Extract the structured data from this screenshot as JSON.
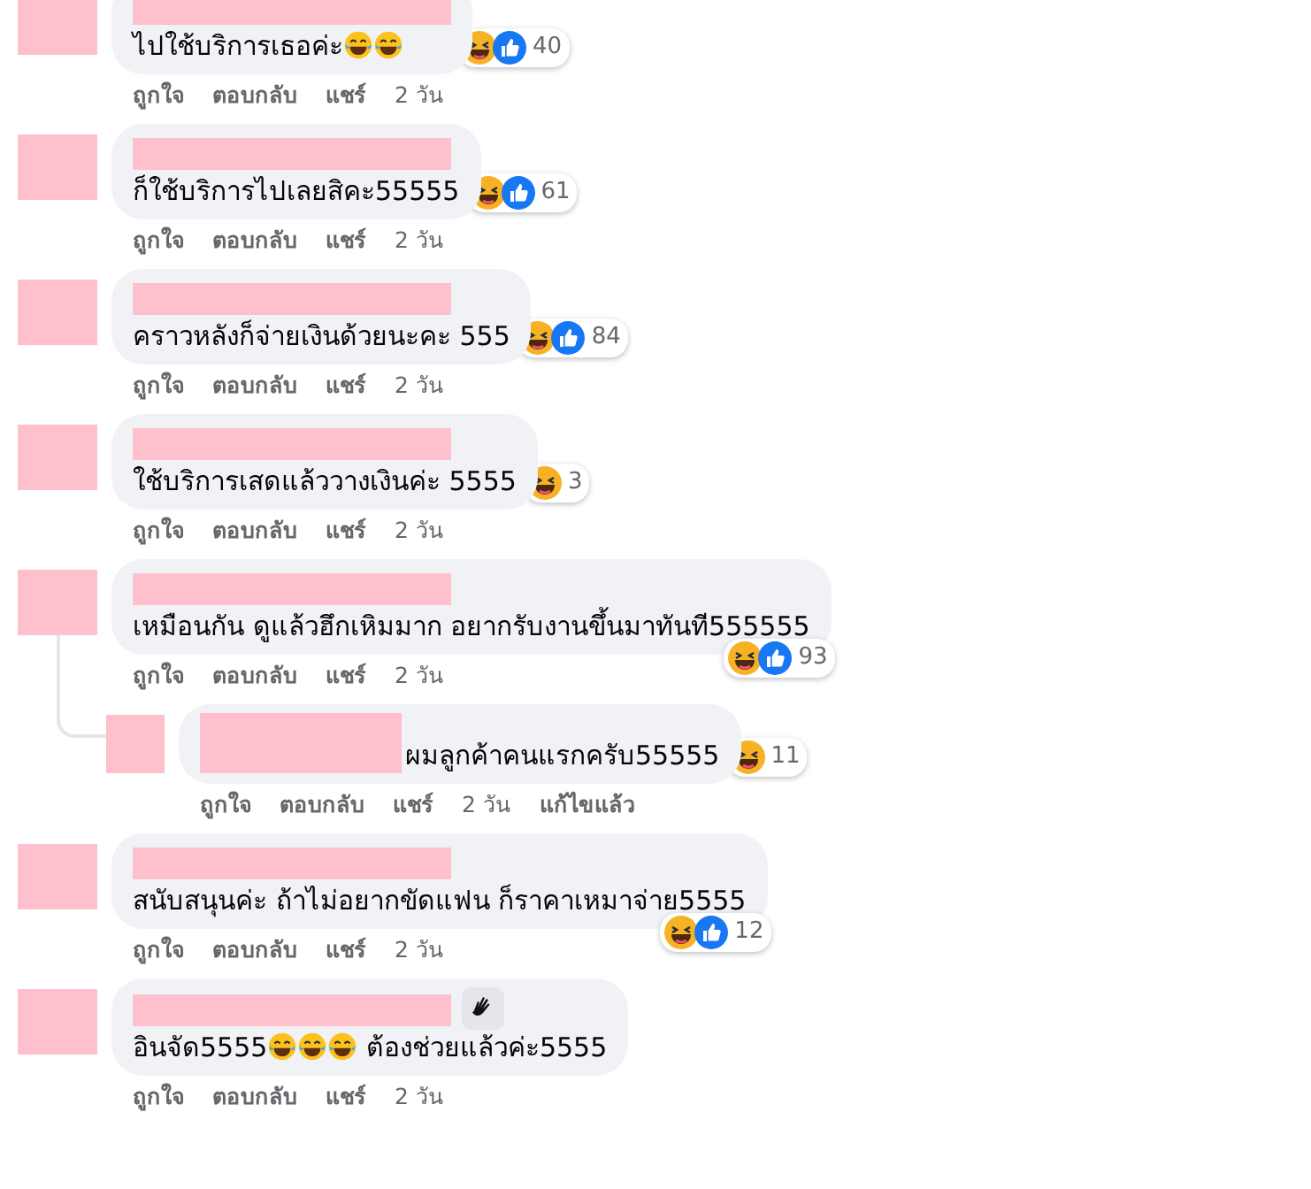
{
  "comments": [
    {
      "kind": "stacked",
      "name_badge": false,
      "parts": [
        {
          "kind": "text",
          "text": "ไปใช้บริการเธอค่ะ"
        },
        {
          "kind": "emoji"
        },
        {
          "kind": "emoji"
        }
      ],
      "reactions": {
        "under": false,
        "icons": [
          {
            "kind": "haha"
          },
          {
            "kind": "like"
          }
        ],
        "count": "40"
      },
      "actions": [
        "ถูกใจ",
        "ตอบกลับ",
        "แชร์",
        "2 วัน"
      ]
    },
    {
      "kind": "stacked",
      "name_badge": false,
      "parts": [
        {
          "kind": "text",
          "text": "ก็ใช้บริการไปเลยสิคะ55555"
        }
      ],
      "reactions": {
        "under": false,
        "icons": [
          {
            "kind": "haha"
          },
          {
            "kind": "like"
          }
        ],
        "count": "61"
      },
      "actions": [
        "ถูกใจ",
        "ตอบกลับ",
        "แชร์",
        "2 วัน"
      ]
    },
    {
      "kind": "stacked",
      "name_badge": false,
      "parts": [
        {
          "kind": "text",
          "text": "คราวหลังก็จ่ายเงินด้วยนะคะ 555"
        }
      ],
      "reactions": {
        "under": false,
        "icons": [
          {
            "kind": "haha"
          },
          {
            "kind": "like"
          }
        ],
        "count": "84"
      },
      "actions": [
        "ถูกใจ",
        "ตอบกลับ",
        "แชร์",
        "2 วัน"
      ]
    },
    {
      "kind": "stacked",
      "name_badge": false,
      "parts": [
        {
          "kind": "text",
          "text": "ใช้บริการเสดแล้ววางเงินค่ะ 5555"
        }
      ],
      "reactions": {
        "under": false,
        "icons": [
          {
            "kind": "haha"
          }
        ],
        "count": "3"
      },
      "actions": [
        "ถูกใจ",
        "ตอบกลับ",
        "แชร์",
        "2 วัน"
      ]
    },
    {
      "kind": "stacked",
      "name_badge": false,
      "parts": [
        {
          "kind": "text",
          "text": "เหมือนกัน ดูแล้วฮึกเหิมมาก อยากรับงานขึ้นมาทันที555555"
        }
      ],
      "reactions": {
        "under": true,
        "icons": [
          {
            "kind": "haha"
          },
          {
            "kind": "like"
          }
        ],
        "count": "93"
      },
      "actions": [
        "ถูกใจ",
        "ตอบกลับ",
        "แชร์",
        "2 วัน"
      ],
      "children": [
        {
          "kind": "inline",
          "name_badge": false,
          "parts": [
            {
              "kind": "text",
              "text": "ผมลูกค้าคนแรกครับ55555"
            }
          ],
          "reactions": {
            "under": false,
            "icons": [
              {
                "kind": "haha"
              }
            ],
            "count": "11"
          },
          "actions": [
            "ถูกใจ",
            "ตอบกลับ",
            "แชร์",
            "2 วัน",
            "แก้ไขแล้ว"
          ]
        }
      ]
    },
    {
      "kind": "stacked",
      "name_badge": false,
      "parts": [
        {
          "kind": "text",
          "text": "สนับสนุนค่ะ ถ้าไม่อยากขัดแฟน ก็ราคาเหมาจ่าย5555"
        }
      ],
      "reactions": {
        "under": true,
        "icons": [
          {
            "kind": "haha"
          },
          {
            "kind": "like"
          }
        ],
        "count": "12"
      },
      "actions": [
        "ถูกใจ",
        "ตอบกลับ",
        "แชร์",
        "2 วัน"
      ]
    },
    {
      "kind": "stacked",
      "name_badge": true,
      "parts": [
        {
          "kind": "text",
          "text": "อินจัด5555"
        },
        {
          "kind": "emoji"
        },
        {
          "kind": "emoji"
        },
        {
          "kind": "emoji"
        },
        {
          "kind": "text",
          "text": " ต้องช่วยแล้วค่ะ5555"
        }
      ],
      "actions": [
        "ถูกใจ",
        "ตอบกลับ",
        "แชร์",
        "2 วัน"
      ]
    }
  ]
}
